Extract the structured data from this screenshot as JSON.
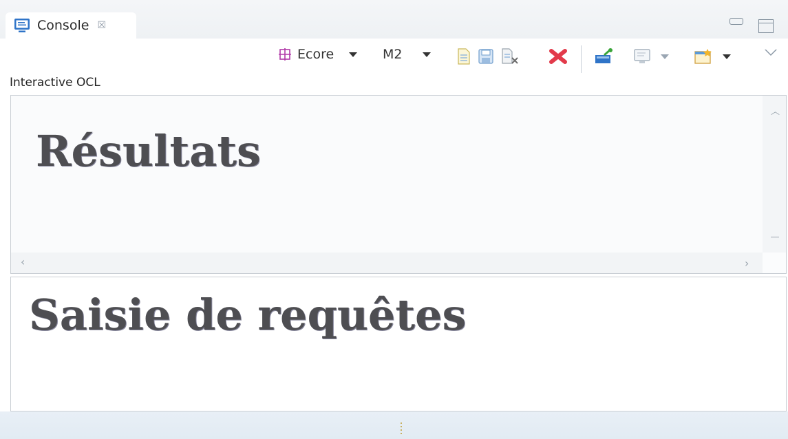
{
  "tab": {
    "label": "Console",
    "icon": "console-icon",
    "close_glyph": "☒"
  },
  "window_controls": {
    "minimize_icon": "minimize-icon",
    "maximize_icon": "maximize-icon"
  },
  "toolbar": {
    "metamodel_label": "Ecore",
    "level_label": "M2",
    "icons": [
      "ecore-icon",
      "load-document-icon",
      "save-document-icon",
      "clear-document-icon",
      "delete-icon",
      "connect-icon",
      "console-display-icon",
      "new-window-icon",
      "view-menu-icon"
    ]
  },
  "section_label": "Interactive OCL",
  "results": {
    "title": "Résultats"
  },
  "query": {
    "title": "Saisie de requêtes"
  },
  "colors": {
    "accent": "#2f74c8",
    "heading": "#4e4e52",
    "delete": "#e23a4a"
  }
}
